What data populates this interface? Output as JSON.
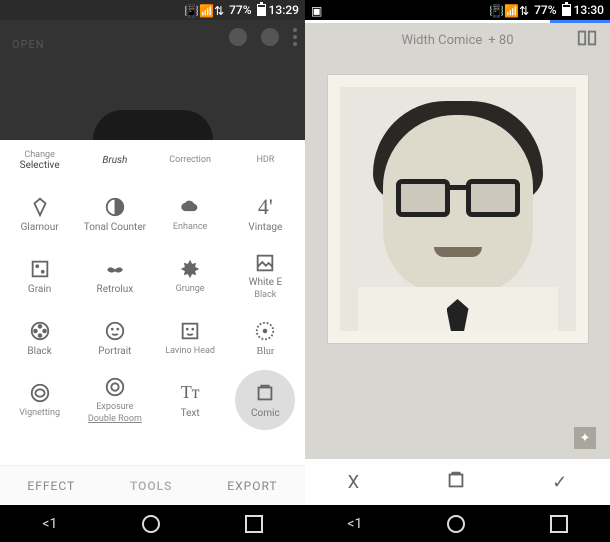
{
  "status_left": {
    "battery_pct": "77%",
    "time": "13:29"
  },
  "status_right": {
    "battery_pct": "77%",
    "time": "13:30"
  },
  "left_header": {
    "open_label": "OPEN"
  },
  "row1": [
    {
      "top": "Change",
      "bottom": "Selective"
    },
    {
      "top": "Brush",
      "bottom": ""
    },
    {
      "top": "Correction",
      "bottom": ""
    },
    {
      "top": "HDR",
      "bottom": ""
    }
  ],
  "tools": [
    {
      "id": "glamour",
      "label": "Glamour",
      "icon": "diamond"
    },
    {
      "id": "tonal",
      "label": "Tonal Counter",
      "icon": "contrast"
    },
    {
      "id": "enhance",
      "label": "Enhance",
      "icon": "cloud"
    },
    {
      "id": "vintage",
      "label": "Vintage",
      "icon": "four"
    },
    {
      "id": "grain",
      "label": "Grain",
      "icon": "dice"
    },
    {
      "id": "retrolux",
      "label": "Retrolux",
      "icon": "mustache"
    },
    {
      "id": "grunge",
      "label": "Grunge",
      "icon": "splat"
    },
    {
      "id": "whitee",
      "label": "White E",
      "sub": "Black",
      "icon": "image"
    },
    {
      "id": "black",
      "label": "Black",
      "icon": "reel"
    },
    {
      "id": "portrait",
      "label": "Portrait",
      "icon": "face"
    },
    {
      "id": "lavino",
      "label": "Lavino Head",
      "icon": "facebox"
    },
    {
      "id": "blur",
      "label": "Blur",
      "icon": "dotcircle"
    },
    {
      "id": "vignette",
      "label": "Vignetting",
      "icon": "vignette"
    },
    {
      "id": "exposure",
      "label": "Exposure",
      "sub": "Double Room",
      "icon": "exposure"
    },
    {
      "id": "text",
      "label": "Text",
      "icon": "text"
    },
    {
      "id": "comic",
      "label": "Comic",
      "icon": "frame",
      "selected": true
    }
  ],
  "bottom_tabs": {
    "effect": "EFFECT",
    "tools": "TOOLS",
    "export": "EXPORT"
  },
  "right_header": {
    "label": "Width Comice",
    "value": "+ 80"
  },
  "right_actions": {
    "cancel": "X",
    "apply": "✓"
  },
  "nav": {
    "back": "<1"
  }
}
